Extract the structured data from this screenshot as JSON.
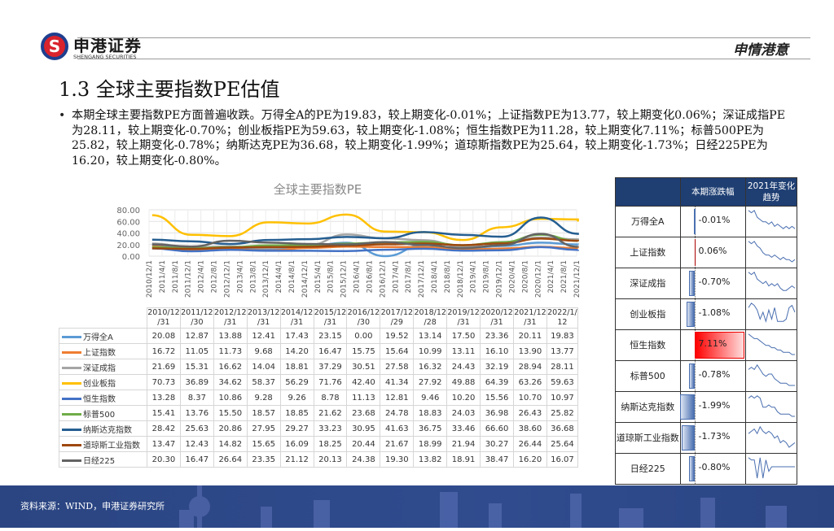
{
  "header": {
    "logo_mark": "S",
    "company_cn": "申港证券",
    "company_en": "SHENGANG SECURITIES",
    "slogan": "申情港意"
  },
  "title": "1.3 全球主要指数PE估值",
  "bullet": "本期全球主要指数PE方面普遍收跌。万得全A的PE为19.83，较上期变化-0.01%；上证指数PE为13.77，较上期变化0.06%；深证成指PE为28.11，较上期变化-0.70%；创业板指PE为59.63，较上期变化-1.08%；恒生指数PE为11.28，较上期变化7.11%；标普500PE为25.82，较上期变化-0.78%；纳斯达克PE为36.68，较上期变化-1.99%；道琼斯指数PE为25.64，较上期变化-1.73%；日经225PE为16.20，较上期变化-0.80%。",
  "chart_data": {
    "type": "line",
    "title": "全球主要指数PE",
    "ylim": [
      0,
      80
    ],
    "yticks": [
      "80.00",
      "60.00",
      "40.00",
      "20.00",
      "0.00"
    ],
    "xticks": [
      "2010/12/1",
      "2011/4/1",
      "2011/8/1",
      "2011/12/1",
      "2012/4/1",
      "2012/8/1",
      "2012/12/1",
      "2013/4/1",
      "2013/8/1",
      "2013/12/1",
      "2014/4/1",
      "2014/8/1",
      "2014/12/1",
      "2015/4/1",
      "2015/8/1",
      "2015/12/1",
      "2016/4/1",
      "2016/8/1",
      "2016/12/1",
      "2017/4/1",
      "2017/8/1",
      "2017/12/1",
      "2018/4/1",
      "2018/8/1",
      "2018/12/1",
      "2019/4/1",
      "2019/8/1",
      "2019/12/1",
      "2020/4/1",
      "2020/8/1",
      "2020/12/1",
      "2021/4/1",
      "2021/8/1",
      "2021/12/1"
    ],
    "grid": true,
    "legend": "table-bottom",
    "x": [
      "2010/12/31",
      "2011/12/30",
      "2012/12/31",
      "2013/12/31",
      "2014/12/31",
      "2015/12/31",
      "2016/12/30",
      "2017/12/29",
      "2018/12/28",
      "2019/12/31",
      "2020/12/31",
      "2021/12/31",
      "2022/1/12"
    ],
    "x_header": [
      [
        "2010/12",
        "/31"
      ],
      [
        "2011/12",
        "/30"
      ],
      [
        "2012/12",
        "/31"
      ],
      [
        "2013/12",
        "/31"
      ],
      [
        "2014/12",
        "/31"
      ],
      [
        "2015/12",
        "/31"
      ],
      [
        "2016/12",
        "/30"
      ],
      [
        "2017/12",
        "/29"
      ],
      [
        "2018/12",
        "/28"
      ],
      [
        "2019/12",
        "/31"
      ],
      [
        "2020/12",
        "/31"
      ],
      [
        "2021/12",
        "/31"
      ],
      [
        "2022/1/",
        "12"
      ]
    ],
    "series": [
      {
        "name": "万得全A",
        "color": "#5b9bd5",
        "values": [
          "20.08",
          "12.87",
          "13.88",
          "12.41",
          "17.43",
          "23.15",
          "0.00",
          "19.52",
          "13.14",
          "17.50",
          "23.36",
          "20.11",
          "19.83"
        ]
      },
      {
        "name": "上证指数",
        "color": "#ed7d31",
        "values": [
          "16.72",
          "11.05",
          "11.73",
          "9.68",
          "14.20",
          "16.47",
          "15.75",
          "15.64",
          "10.99",
          "13.11",
          "16.10",
          "13.90",
          "13.77"
        ]
      },
      {
        "name": "深证成指",
        "color": "#a5a5a5",
        "values": [
          "21.69",
          "15.31",
          "16.62",
          "14.04",
          "18.81",
          "37.29",
          "30.51",
          "27.58",
          "16.32",
          "24.43",
          "32.19",
          "28.94",
          "28.11"
        ]
      },
      {
        "name": "创业板指",
        "color": "#ffc000",
        "values": [
          "70.73",
          "36.89",
          "34.62",
          "58.37",
          "56.29",
          "71.76",
          "42.40",
          "41.34",
          "27.92",
          "49.88",
          "64.39",
          "63.26",
          "59.63"
        ]
      },
      {
        "name": "恒生指数",
        "color": "#4472c4",
        "values": [
          "13.28",
          "8.37",
          "10.86",
          "9.28",
          "9.26",
          "8.78",
          "11.13",
          "12.81",
          "9.46",
          "10.20",
          "15.56",
          "10.70",
          "10.97"
        ]
      },
      {
        "name": "标普500",
        "color": "#70ad47",
        "values": [
          "15.41",
          "13.76",
          "15.50",
          "18.57",
          "18.85",
          "21.62",
          "23.68",
          "24.78",
          "18.83",
          "24.03",
          "36.98",
          "26.43",
          "25.82"
        ]
      },
      {
        "name": "纳斯达克指数",
        "color": "#255e91",
        "values": [
          "28.42",
          "25.63",
          "20.86",
          "27.95",
          "29.27",
          "33.23",
          "30.95",
          "41.63",
          "36.75",
          "33.46",
          "66.60",
          "38.60",
          "36.68"
        ]
      },
      {
        "name": "道琼斯工业指数",
        "color": "#9e480e",
        "values": [
          "13.47",
          "12.43",
          "14.82",
          "15.65",
          "16.09",
          "18.25",
          "20.44",
          "21.67",
          "18.99",
          "21.94",
          "30.27",
          "26.44",
          "25.64"
        ]
      },
      {
        "name": "日经225",
        "color": "#636363",
        "values": [
          "20.30",
          "16.47",
          "26.64",
          "23.35",
          "21.12",
          "20.13",
          "24.38",
          "19.30",
          "13.82",
          "18.91",
          "38.47",
          "16.20",
          "16.07"
        ]
      }
    ]
  },
  "panel": {
    "col_change": "本期涨跌幅",
    "col_trend": "2021年变化趋势",
    "rows": [
      {
        "name": "万得全A",
        "change": "-0.01%",
        "value": -0.01,
        "spark": [
          9,
          8,
          9,
          6,
          5,
          4,
          4,
          3,
          4,
          2,
          3,
          2,
          1,
          2,
          1,
          2,
          1
        ]
      },
      {
        "name": "上证指数",
        "change": "0.06%",
        "value": 0.06,
        "spark": [
          9,
          8,
          9,
          7,
          6,
          4,
          3,
          3,
          2,
          3,
          2,
          1,
          2,
          1,
          1,
          0,
          1
        ]
      },
      {
        "name": "深证成指",
        "change": "-0.70%",
        "value": -0.7,
        "spark": [
          9,
          8,
          9,
          6,
          5,
          4,
          5,
          3,
          4,
          3,
          4,
          2,
          1,
          1,
          2,
          3,
          2
        ]
      },
      {
        "name": "创业板指",
        "change": "-1.08%",
        "value": -1.08,
        "spark": [
          7,
          9,
          8,
          6,
          2,
          5,
          1,
          6,
          2,
          7,
          1,
          1,
          1,
          2,
          7,
          8,
          5
        ]
      },
      {
        "name": "恒生指数",
        "change": "7.11%",
        "value": 7.11,
        "spark": [
          9,
          8,
          7,
          7,
          6,
          5,
          4,
          4,
          3,
          3,
          2,
          2,
          1,
          1,
          1,
          0,
          0
        ]
      },
      {
        "name": "标普500",
        "change": "-0.78%",
        "value": -0.78,
        "spark": [
          7,
          8,
          7,
          9,
          7,
          5,
          4,
          5,
          5,
          3,
          2,
          1,
          1,
          1,
          0,
          0,
          0
        ]
      },
      {
        "name": "纳斯达克指数",
        "change": "-1.99%",
        "value": -1.99,
        "spark": [
          8,
          9,
          8,
          9,
          8,
          4,
          4,
          5,
          4,
          4,
          2,
          1,
          1,
          1,
          1,
          0,
          0
        ]
      },
      {
        "name": "道琼斯工业指数",
        "change": "-1.73%",
        "value": -1.73,
        "spark": [
          6,
          7,
          8,
          6,
          9,
          7,
          6,
          7,
          6,
          4,
          5,
          2,
          3,
          2,
          0,
          1,
          2
        ]
      },
      {
        "name": "日经225",
        "change": "-0.80%",
        "value": -0.8,
        "spark": [
          9,
          8,
          8,
          0,
          9,
          0,
          8,
          3,
          5,
          5,
          5,
          5,
          5,
          5,
          5,
          5,
          5
        ]
      }
    ]
  },
  "footer": {
    "source": "资料来源：WIND，申港证券研究所"
  }
}
